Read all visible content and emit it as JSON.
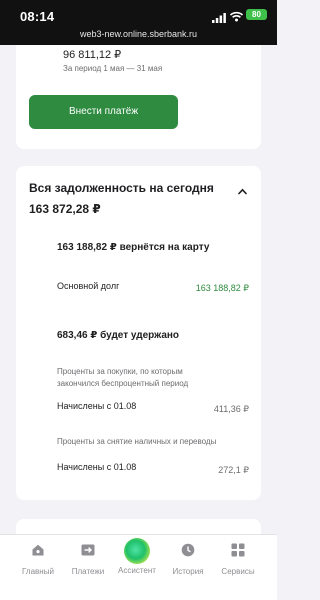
{
  "status_bar": {
    "time": "08:14",
    "battery": "80"
  },
  "browser": {
    "url": "web3-new.online.sberbank.ru"
  },
  "top_card": {
    "amount": "96 811,12 ₽",
    "period": "За период 1 мая — 31 мая",
    "pay_button": "Внести платёж"
  },
  "debt_card": {
    "title": "Вся задолженность на сегодня",
    "total": "163 872,28 ₽",
    "refund": "163 188,82 ₽ вернётся на карту",
    "main_debt_label": "Основной долг",
    "main_debt_value": "163 188,82 ₽",
    "withheld": "683,46 ₽ будет удержано",
    "note_purchases": "Проценты за покупки, по которым закончился беспроцентный период",
    "charged_1_label": "Начислены с 01.08",
    "charged_1_value": "411,36 ₽",
    "note_cash": "Проценты за снятие наличных и переводы",
    "charged_2_label": "Начислены с 01.08",
    "charged_2_value": "272,1 ₽"
  },
  "tabs": [
    {
      "label": "Главный",
      "icon": "home-icon"
    },
    {
      "label": "Платежи",
      "icon": "payments-icon"
    },
    {
      "label": "Ассистент",
      "icon": "assistant-orb-icon"
    },
    {
      "label": "История",
      "icon": "history-clock-icon"
    },
    {
      "label": "Сервисы",
      "icon": "services-grid-icon"
    }
  ],
  "colors": {
    "accent_green": "#2e8b40",
    "background": "#f2f2f7"
  }
}
